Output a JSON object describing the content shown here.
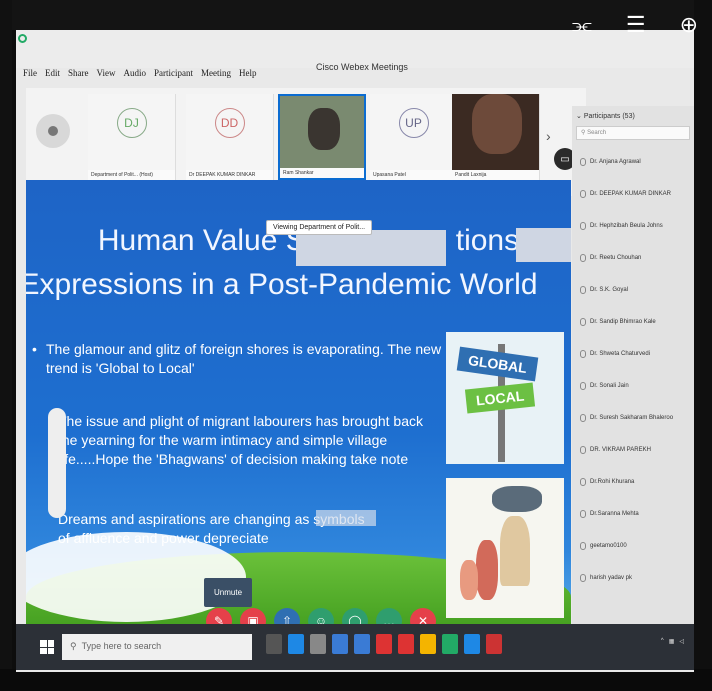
{
  "window": {
    "title": "Cisco Webex Meetings"
  },
  "menu": [
    "File",
    "Edit",
    "Share",
    "View",
    "Audio",
    "Participant",
    "Meeting",
    "Help"
  ],
  "video_tiles": [
    {
      "initials": "DJ",
      "name": "Department of Polit... (Host)",
      "type": "avatar"
    },
    {
      "initials": "DD",
      "name": "Dr DEEPAK KUMAR DINKAR",
      "type": "avatar"
    },
    {
      "initials": "",
      "name": "Ram Shankar",
      "type": "video"
    },
    {
      "initials": "UP",
      "name": "Upasana Patel",
      "type": "avatar"
    },
    {
      "initials": "",
      "name": "Pandit Laxnija",
      "type": "video2"
    }
  ],
  "tooltip": "Viewing Department of Polit...",
  "slide": {
    "title_line1_left": "Human Value S",
    "title_line1_right": "tions",
    "title_line2": "Expressions in a Post-Pandemic World",
    "bullets": [
      "The glamour and glitz of foreign shores is evaporating. The new trend is 'Global to Local'",
      "The issue and plight of migrant labourers has brought back the yearning for the warm intimacy and simple village life.....Hope the 'Bhagwans' of decision making take note",
      "Dreams and aspirations are changing as symbols of affluence and power depreciate"
    ],
    "sign_global": "GLOBAL",
    "sign_local": "LOCAL"
  },
  "unmute_label": "Unmute",
  "participants": {
    "header": "Participants (53)",
    "search_placeholder": "Search",
    "items": [
      "Dr. Anjana Agrawal",
      "Dr. DEEPAK KUMAR DINKAR",
      "Dr. Hephzibah Beula Johns",
      "Dr. Reetu Chouhan",
      "Dr. S.K. Goyal",
      "Dr. Sandip Bhimrao Kale",
      "Dr. Shweta Chaturvedi",
      "Dr. Sonali Jain",
      "Dr. Suresh Sakharam Bhaleroo",
      "DR. VIKRAM PAREKH",
      "Dr.Rohi Khurana",
      "Dr.Saranna Mehta",
      "geetamo0100",
      "harish yadav pk"
    ]
  },
  "taskbar": {
    "search_placeholder": "Type here to search"
  },
  "colors": {
    "slide_blue": "#1e64c6",
    "grass": "#3e9a1c",
    "webex_blue": "#0b6cd1",
    "control_red": "#e5404a",
    "control_green": "#2f9e6e"
  }
}
